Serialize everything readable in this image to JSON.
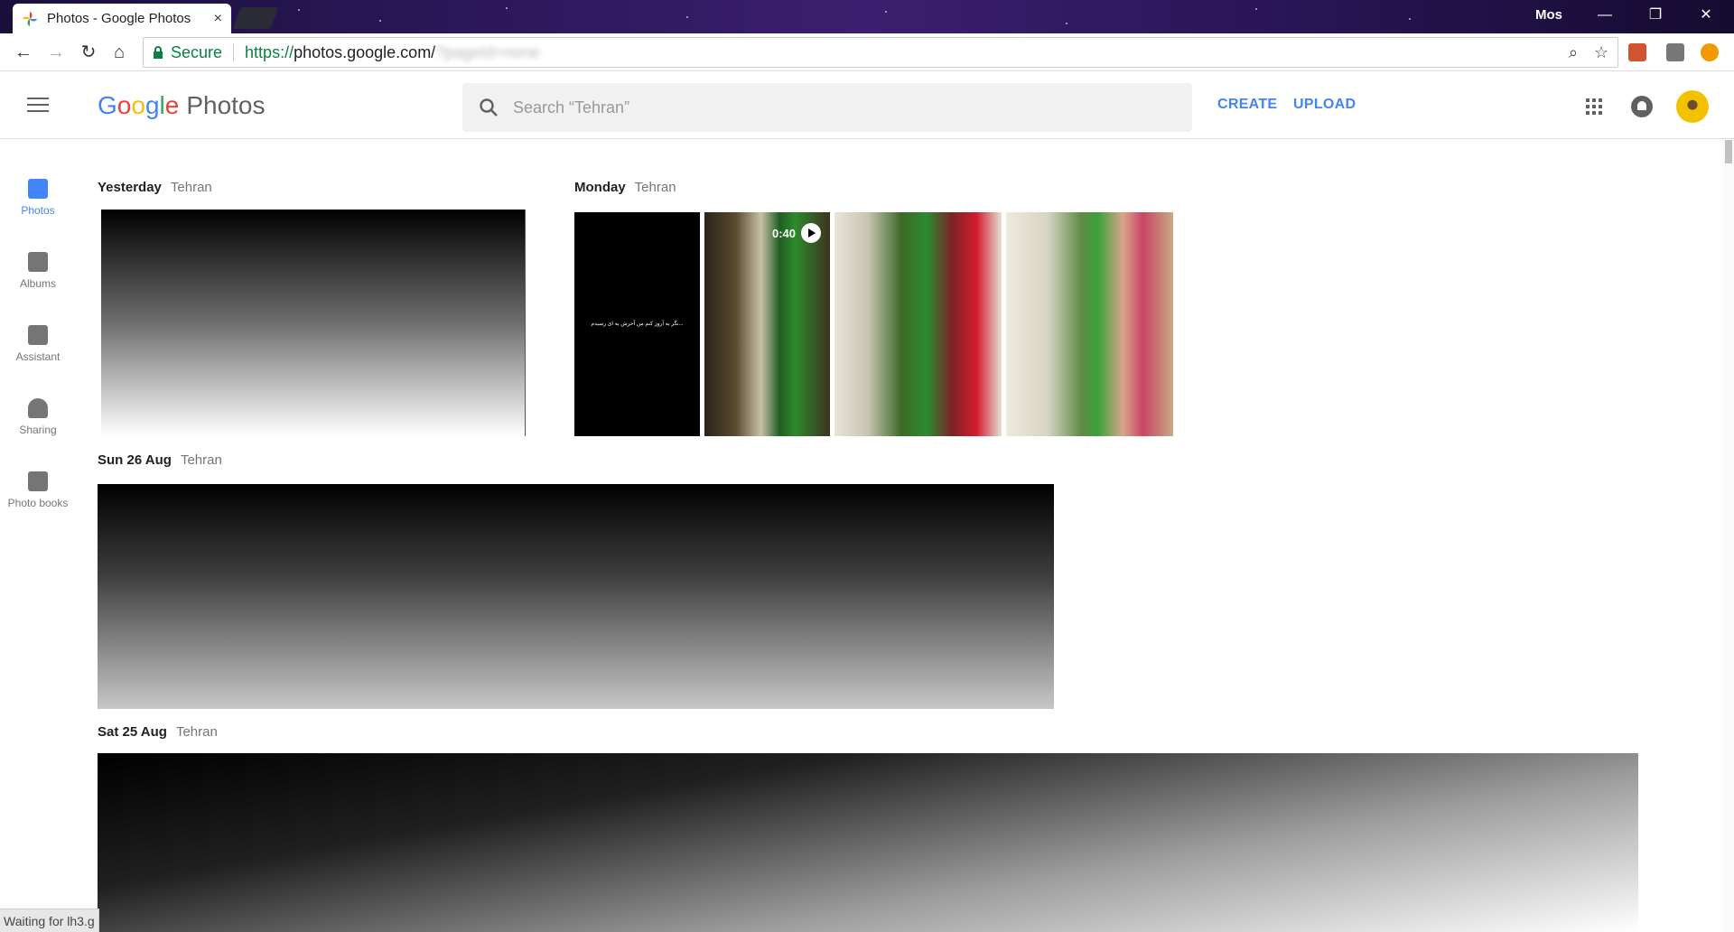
{
  "browser": {
    "tab_title": "Photos - Google Photos",
    "tab_close": "×",
    "user": "Mos",
    "secure_label": "Secure",
    "url_scheme": "https://",
    "url_host": "photos.google.com/",
    "url_path_blurred": "?pageId=none"
  },
  "window_controls": {
    "minimize": "—",
    "restore": "❐",
    "close": "✕"
  },
  "nav_buttons": {
    "back": "←",
    "forward": "→",
    "reload": "↻",
    "home": "⌂"
  },
  "omnibox_icons": {
    "zoom": "⌕",
    "star": "☆"
  },
  "header": {
    "logo": [
      "G",
      "o",
      "o",
      "g",
      "l",
      "e"
    ],
    "logo_suffix": "Photos",
    "search_placeholder": "Search “Tehran”",
    "create": "CREATE",
    "upload": "UPLOAD"
  },
  "sidenav": [
    {
      "label": "Photos",
      "icon": "photo-icon",
      "active": true
    },
    {
      "label": "Albums",
      "icon": "albums-icon",
      "active": false
    },
    {
      "label": "Assistant",
      "icon": "assistant-icon",
      "active": false
    },
    {
      "label": "Sharing",
      "icon": "sharing-icon",
      "active": false
    },
    {
      "label": "Photo books",
      "icon": "photo-books-icon",
      "active": false
    }
  ],
  "sections": {
    "yesterday": {
      "date": "Yesterday",
      "place": "Tehran"
    },
    "monday": {
      "date": "Monday",
      "place": "Tehran"
    },
    "sun": {
      "date": "Sun 26 Aug",
      "place": "Tehran"
    },
    "sat": {
      "date": "Sat 25 Aug",
      "place": "Tehran"
    }
  },
  "video": {
    "duration": "0:40"
  },
  "black_frame_text": "نگر یه آروز کنم من آخرش یه ای رسیدم...",
  "status": "Waiting for lh3.g"
}
